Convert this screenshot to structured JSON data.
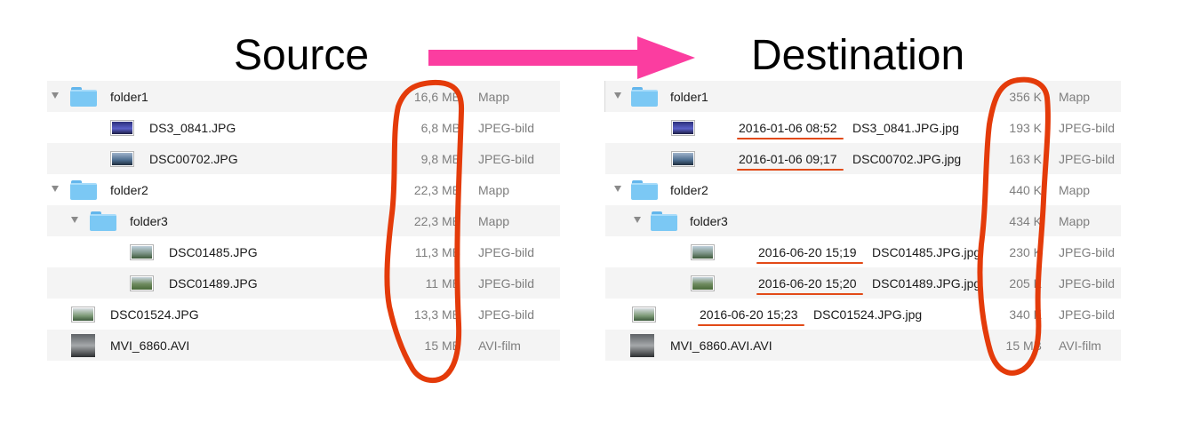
{
  "headings": {
    "source": "Source",
    "destination": "Destination"
  },
  "colors": {
    "arrow": "#fb3da0",
    "annotation": "#e43b0a",
    "folder": "#7bc8f4",
    "row_alt": "#f4f4f4",
    "secondary_text": "#7e7e7e"
  },
  "source": {
    "rows": [
      {
        "name": "folder1",
        "size": "16,6 MB",
        "kind": "Mapp",
        "depth": 0,
        "type": "folder"
      },
      {
        "name": "DS3_0841.JPG",
        "size": "6,8 MB",
        "kind": "JPEG-bild",
        "depth": 1,
        "type": "image"
      },
      {
        "name": "DSC00702.JPG",
        "size": "9,8 MB",
        "kind": "JPEG-bild",
        "depth": 1,
        "type": "image"
      },
      {
        "name": "folder2",
        "size": "22,3 MB",
        "kind": "Mapp",
        "depth": 0,
        "type": "folder"
      },
      {
        "name": "folder3",
        "size": "22,3 MB",
        "kind": "Mapp",
        "depth": 1,
        "type": "folder"
      },
      {
        "name": "DSC01485.JPG",
        "size": "11,3 MB",
        "kind": "JPEG-bild",
        "depth": 2,
        "type": "image"
      },
      {
        "name": "DSC01489.JPG",
        "size": "11 MB",
        "kind": "JPEG-bild",
        "depth": 2,
        "type": "image"
      },
      {
        "name": "DSC01524.JPG",
        "size": "13,3 MB",
        "kind": "JPEG-bild",
        "depth": 0,
        "type": "image"
      },
      {
        "name": "MVI_6860.AVI",
        "size": "15 MB",
        "kind": "AVI-film",
        "depth": 0,
        "type": "video"
      }
    ]
  },
  "destination": {
    "rows": [
      {
        "name": "folder1",
        "prefix": "",
        "size": "356 K",
        "kind": "Mapp",
        "depth": 0,
        "type": "folder"
      },
      {
        "name": "DS3_0841.JPG.jpg",
        "prefix": "2016-01-06 08;52",
        "size": "193 K",
        "kind": "JPEG-bild",
        "depth": 1,
        "type": "image"
      },
      {
        "name": "DSC00702.JPG.jpg",
        "prefix": "2016-01-06 09;17",
        "size": "163 K",
        "kind": "JPEG-bild",
        "depth": 1,
        "type": "image"
      },
      {
        "name": "folder2",
        "prefix": "",
        "size": "440 K",
        "kind": "Mapp",
        "depth": 0,
        "type": "folder"
      },
      {
        "name": "folder3",
        "prefix": "",
        "size": "434 K",
        "kind": "Mapp",
        "depth": 1,
        "type": "folder"
      },
      {
        "name": "DSC01485.JPG.jpg",
        "prefix": "2016-06-20 15;19",
        "size": "230 K",
        "kind": "JPEG-bild",
        "depth": 2,
        "type": "image"
      },
      {
        "name": "DSC01489.JPG.jpg",
        "prefix": "2016-06-20 15;20",
        "size": "205 K",
        "kind": "JPEG-bild",
        "depth": 2,
        "type": "image"
      },
      {
        "name": "DSC01524.JPG.jpg",
        "prefix": "2016-06-20 15;23",
        "size": "340 K",
        "kind": "JPEG-bild",
        "depth": 0,
        "type": "image"
      },
      {
        "name": "MVI_6860.AVI.AVI",
        "prefix": "",
        "size": "15 MB",
        "kind": "AVI-film",
        "depth": 0,
        "type": "video"
      }
    ]
  }
}
